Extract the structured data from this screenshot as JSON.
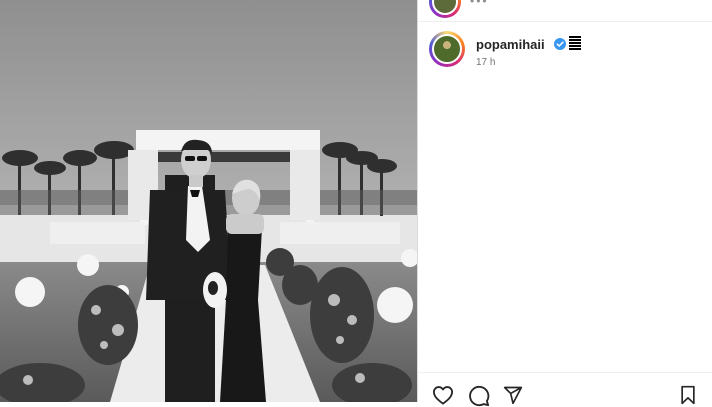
{
  "photo": {
    "description_icon": "wedding-photo",
    "colors": {
      "sky": "#a9a9a9",
      "pavilion": "#f2f2f2",
      "ground": "#d9d9d9"
    }
  },
  "post": {
    "username": "popamihaii",
    "verified": true,
    "timestamp": "17 h"
  },
  "actions": {
    "icons": [
      "heart-icon",
      "comment-icon",
      "share-icon",
      "bookmark-icon"
    ]
  },
  "colors": {
    "verified_blue": "#3897f0",
    "text": "#262626",
    "muted": "#737373",
    "border": "#dbdbdb"
  }
}
